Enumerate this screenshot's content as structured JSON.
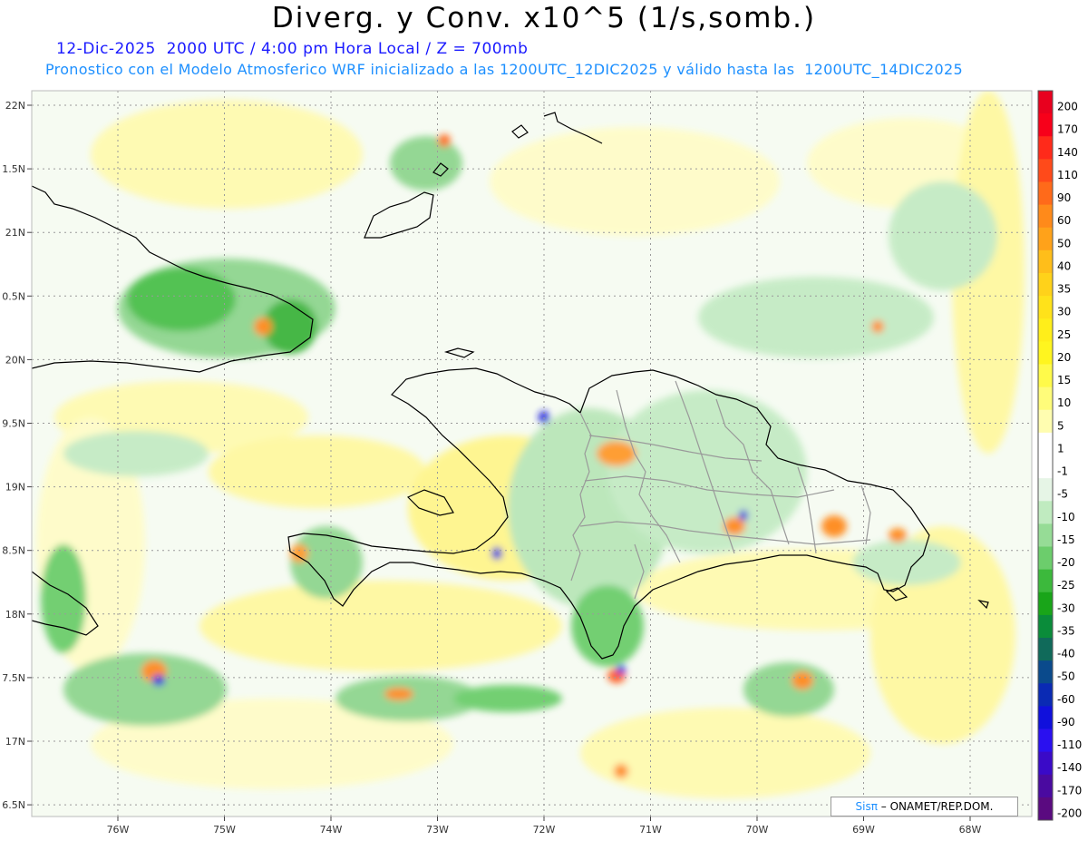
{
  "header": {
    "title": "Diverg. y Conv. x10^5 (1/s,somb.)",
    "line1": "12-Dic-2025  2000 UTC / 4:00 pm Hora Local / Z = 700mb",
    "line2": "Pronostico con el Modelo Atmosferico WRF inicializado a las 1200UTC_12DIC2025 y válido hasta las  1200UTC_14DIC2025"
  },
  "axes": {
    "y_labels": [
      "22N",
      "1.5N",
      "21N",
      "0.5N",
      "20N",
      "9.5N",
      "19N",
      "8.5N",
      "18N",
      "7.5N",
      "17N",
      "6.5N"
    ],
    "x_labels": [
      "76W",
      "75W",
      "74W",
      "73W",
      "72W",
      "71W",
      "70W",
      "69W",
      "68W"
    ]
  },
  "colorbar": {
    "labels": [
      "200",
      "170",
      "140",
      "110",
      "90",
      "60",
      "50",
      "40",
      "35",
      "30",
      "25",
      "20",
      "15",
      "10",
      "5",
      "1",
      "-1",
      "-5",
      "-10",
      "-15",
      "-20",
      "-25",
      "-30",
      "-35",
      "-40",
      "-50",
      "-60",
      "-90",
      "-110",
      "-140",
      "-170",
      "-200"
    ],
    "colors": [
      "#e8001e",
      "#f7001a",
      "#ff2a1a",
      "#ff4a1a",
      "#ff6a1a",
      "#ff8a1a",
      "#ffa21a",
      "#ffbe1a",
      "#ffd21a",
      "#ffe21a",
      "#ffee1a",
      "#fff51f",
      "#fffa4a",
      "#fffc7a",
      "#fffdb0",
      "#ffffff",
      "#ffffff",
      "#e6f5e6",
      "#c0ebc0",
      "#96dc96",
      "#6ccd6c",
      "#3cb93c",
      "#19a519",
      "#0a8c3a",
      "#106a5a",
      "#0a4a8c",
      "#0a2ab4",
      "#1010dc",
      "#2a10f0",
      "#3a0ac8",
      "#4a0aa0",
      "#5a0a80"
    ]
  },
  "credit": {
    "brand": "Sisπ",
    "text": "– ONAMET/REP.DOM."
  }
}
